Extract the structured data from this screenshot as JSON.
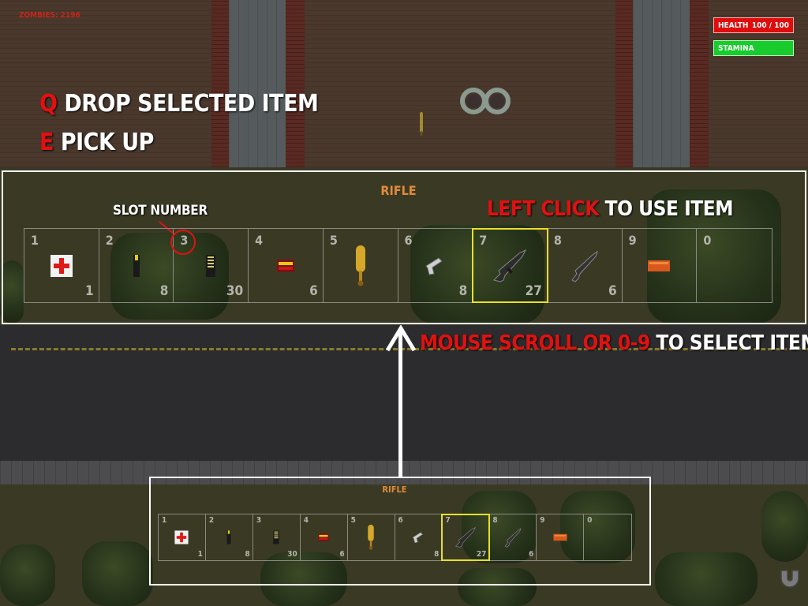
{
  "hud": {
    "zombies_label": "ZOMBIES: 2196",
    "health_label": "HEALTH",
    "health_value": "100 / 100",
    "stamina_label": "STAMINA",
    "health_color": "#e00b0b",
    "stamina_color": "#17cc2c"
  },
  "tips": {
    "drop_key": "Q",
    "drop_text": "DROP SELECTED ITEM",
    "pickup_key": "E",
    "pickup_text": "PICK UP",
    "use_key": "LEFT CLICK",
    "use_text": "TO USE ITEM",
    "select_key": "MOUSE SCROLL OR 0-9",
    "select_text": "TO SELECT ITEMS",
    "slot_number_label": "SLOT NUMBER"
  },
  "inventory": {
    "selected_item_name": "RIFLE",
    "selected_slot": "7",
    "slots": [
      {
        "number": "1",
        "icon": "medkit-icon",
        "count": "1"
      },
      {
        "number": "2",
        "icon": "pistol-ammo-icon",
        "count": "8"
      },
      {
        "number": "3",
        "icon": "rifle-ammo-icon",
        "count": "30"
      },
      {
        "number": "4",
        "icon": "shotgun-shells-icon",
        "count": "6"
      },
      {
        "number": "5",
        "icon": "baseball-bat-icon",
        "count": ""
      },
      {
        "number": "6",
        "icon": "pistol-icon",
        "count": "8"
      },
      {
        "number": "7",
        "icon": "rifle-icon",
        "count": "27"
      },
      {
        "number": "8",
        "icon": "shotgun-icon",
        "count": "6"
      },
      {
        "number": "9",
        "icon": "brick-icon",
        "count": ""
      },
      {
        "number": "0",
        "icon": "",
        "count": ""
      }
    ]
  },
  "colors": {
    "key_highlight": "#e21111",
    "selected_item_title": "#e38a3a",
    "selected_slot_outline": "#e8e02a"
  }
}
